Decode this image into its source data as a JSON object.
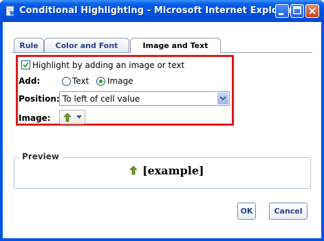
{
  "window": {
    "title": "Conditional Highlighting - Microsoft Internet Explorer",
    "icon": "ie-page-icon",
    "controls": [
      "minimize-icon",
      "maximize-icon",
      "close-icon"
    ]
  },
  "tabs": [
    {
      "label": "Rule",
      "active": false
    },
    {
      "label": "Color and Font",
      "active": false
    },
    {
      "label": "Image and Text",
      "active": true
    }
  ],
  "highlight": {
    "checkbox_label": "Highlight by adding an image or text",
    "checked": true
  },
  "add": {
    "label": "Add:",
    "options": [
      {
        "label": "Text",
        "selected": false
      },
      {
        "label": "Image",
        "selected": true
      }
    ]
  },
  "position": {
    "label": "Position:",
    "value": "To left of cell value"
  },
  "image": {
    "label": "Image:",
    "selected_icon": "green-up-arrow-icon"
  },
  "preview": {
    "legend": "Preview",
    "example_text": "[example]",
    "example_icon": "green-up-arrow-icon"
  },
  "buttons": {
    "ok": "OK",
    "cancel": "Cancel"
  },
  "colors": {
    "titlebar": "#0054e3",
    "highlight_border": "#dd1a1a",
    "tab_text": "#27408b",
    "arrow_green": "#5f8d1e"
  }
}
